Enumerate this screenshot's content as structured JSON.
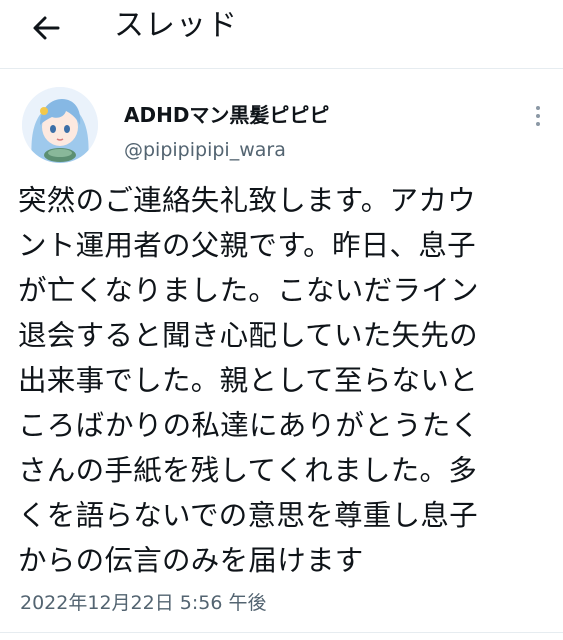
{
  "header": {
    "title": "スレッド",
    "back_icon": "arrow-left-icon"
  },
  "author": {
    "display_name": "ADHDマン黒髪ピピピ",
    "handle": "@pipipipipi_wara",
    "avatar_icon": "avatar-anime-girl"
  },
  "menu": {
    "more_icon": "vertical-ellipsis-icon"
  },
  "tweet": {
    "text": "突然のご連絡失礼致します。アカウ\nント運用者の父親です。昨日、息子\nが亡くなりました。こないだライン\n退会すると聞き心配していた矢先の\n出来事でした。親として至らないと\nころばかりの私達にありがとうたく\nさんの手紙を残してくれました。多\nくを語らないでの意思を尊重し息子\nからの伝言のみを届けます",
    "timestamp": "2022年12月22日 5:56 午後"
  },
  "colors": {
    "text_primary": "#0f1419",
    "text_secondary": "#536471",
    "divider": "#e6ecf0"
  }
}
